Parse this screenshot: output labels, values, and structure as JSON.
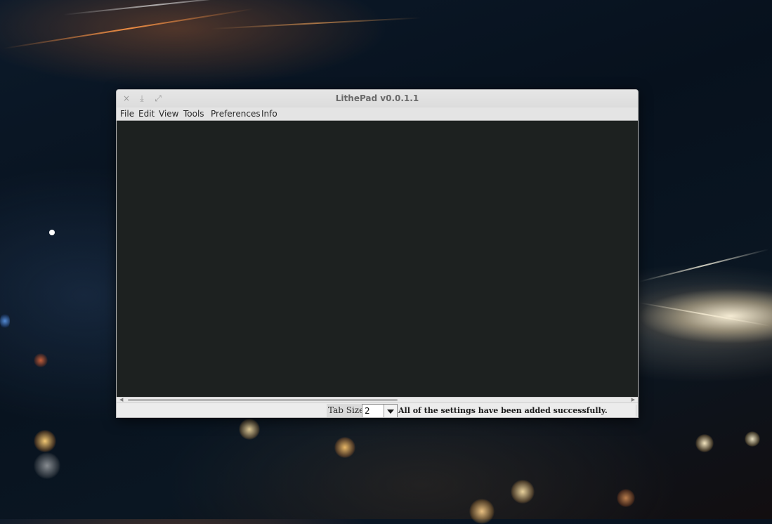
{
  "window": {
    "title": "LithePad v0.0.1.1",
    "controls": {
      "close_icon": "×",
      "minimize_icon": "⤓",
      "maximize_icon": "⤢"
    }
  },
  "menubar": {
    "items": [
      "File",
      "Edit",
      "View",
      "Tools",
      "Preferences",
      "Info"
    ]
  },
  "editor": {
    "content": ""
  },
  "statusbar": {
    "tab_size_label": "Tab Size:",
    "tab_size_value": "2",
    "message": "All of the settings have been added successfully."
  },
  "colors": {
    "editor_background": "#1d2120",
    "window_chrome": "#ececec",
    "title_text": "#6a6a6a"
  }
}
